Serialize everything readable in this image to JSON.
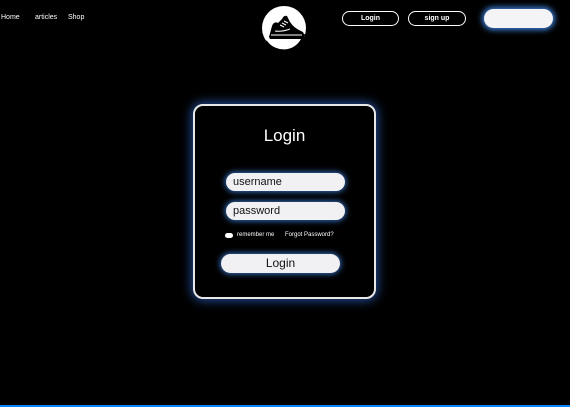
{
  "nav": {
    "links": [
      "Home",
      "articles",
      "Shop"
    ],
    "login_label": "Login",
    "signup_label": "sign up"
  },
  "logo": {
    "icon": "sneaker-logo-icon"
  },
  "login_form": {
    "title": "Login",
    "username_value": "username",
    "password_value": "password",
    "remember_label": "remember me",
    "forgot_label": "Forgot Password?",
    "submit_label": "Login"
  },
  "colors": {
    "background": "#000000",
    "glow": "#4696ff",
    "field_bg": "#f1f1f3",
    "accent_line": "#0a84ff"
  }
}
